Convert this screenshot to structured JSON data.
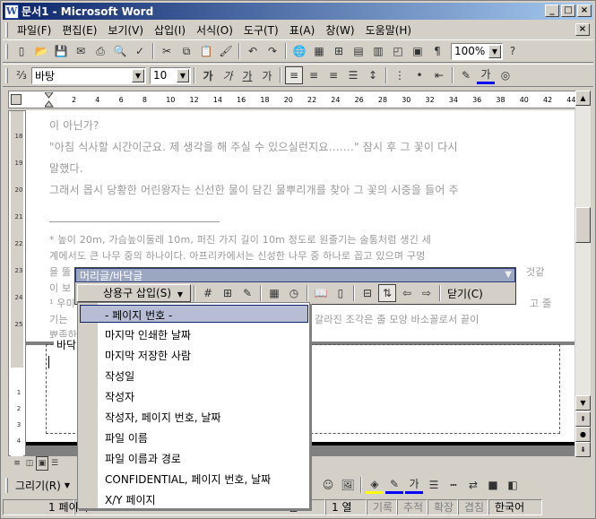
{
  "window": {
    "title": "문서1 - Microsoft Word",
    "app_icon": "word-icon"
  },
  "menubar": [
    "파일(F)",
    "편집(E)",
    "보기(V)",
    "삽입(I)",
    "서식(O)",
    "도구(T)",
    "표(A)",
    "창(W)",
    "도움말(H)"
  ],
  "toolbar": {
    "zoom": "100%"
  },
  "format": {
    "style": "바탕",
    "size": "10"
  },
  "ruler": {
    "ticks": [
      "2",
      "4",
      "6",
      "8",
      "10",
      "12",
      "14",
      "16",
      "18",
      "20",
      "22",
      "24",
      "26",
      "28",
      "30",
      "32",
      "34",
      "36",
      "38",
      "40",
      "42",
      "44"
    ]
  },
  "document": {
    "line1": "이 아닌가?",
    "line2": "\"아침 식사할 시간이군요. 제 생각을 해 주실 수 있으실런지요…….\" 잠시 후 그 꽃이 다시",
    "line3": "말했다.",
    "line4": "그래서 몹시 당황한 어린왕자는 신선한 물이 담긴 물뿌리개를 찾아 그 꽃의 시중을 들어 주",
    "foot1": "* 높이 20m, 가슴높이둘레 10m, 퍼진 가지 길이 10m 정도로 원줄기는 술통처럼 생긴 세",
    "foot2": "계에서도 큰 나무 중의 하나이다. 아프리카에서는 신성한 나무 중 하나로 꼽고 있으며 구멍",
    "foot3": "을 뚫",
    "foot3b": "것같",
    "foot4": "이 보",
    "foot5": "¹ 우미",
    "foot5b": "고 줄",
    "foot6": "기는",
    "foot6b": "갈라진 조각은 줄 모양 바소꼴로서 끝이",
    "foot7": "뾰족하",
    "footer_label": "바닥"
  },
  "header_footer_toolbar": {
    "title": "머리글/바닥글",
    "autotext": "상용구 삽입(S)",
    "close": "닫기(C)"
  },
  "autotext_menu": [
    "- 페이지 번호 -",
    "마지막 인쇄한 날짜",
    "마지막 저장한 사람",
    "작성일",
    "작성자",
    "작성자, 페이지 번호, 날짜",
    "파일 이름",
    "파일 이름과 경로",
    "CONFIDENTIAL, 페이지 번호, 날짜",
    "X/Y 페이지"
  ],
  "drawbar": {
    "draw": "그리기(R)"
  },
  "status": {
    "page": "1 페이지",
    "line": "줄",
    "col": "1 열",
    "rec": "기록",
    "trk": "추적",
    "ext": "확장",
    "ovr": "겹침",
    "lang": "한국어"
  }
}
